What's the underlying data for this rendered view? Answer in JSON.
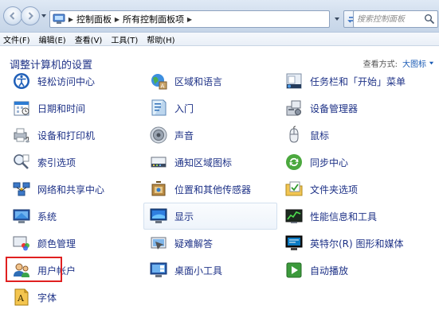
{
  "address_bar": {
    "breadcrumbs": [
      "控制面板",
      "所有控制面板项"
    ],
    "search_placeholder": "搜索控制面板"
  },
  "menubar": {
    "items": [
      "文件(F)",
      "编辑(E)",
      "查看(V)",
      "工具(T)",
      "帮助(H)"
    ]
  },
  "content": {
    "title": "调整计算机的设置",
    "view_label": "查看方式:",
    "view_value": "大图标"
  },
  "items": [
    {
      "label": "轻松访问中心",
      "icon": "ease-of-access-icon"
    },
    {
      "label": "区域和语言",
      "icon": "region-language-icon"
    },
    {
      "label": "任务栏和「开始」菜单",
      "icon": "taskbar-start-menu-icon"
    },
    {
      "label": "日期和时间",
      "icon": "date-time-icon"
    },
    {
      "label": "入门",
      "icon": "getting-started-icon"
    },
    {
      "label": "设备管理器",
      "icon": "device-manager-icon"
    },
    {
      "label": "设备和打印机",
      "icon": "devices-printers-icon"
    },
    {
      "label": "声音",
      "icon": "sound-icon"
    },
    {
      "label": "鼠标",
      "icon": "mouse-icon"
    },
    {
      "label": "索引选项",
      "icon": "indexing-options-icon"
    },
    {
      "label": "通知区域图标",
      "icon": "notification-area-icon"
    },
    {
      "label": "同步中心",
      "icon": "sync-center-icon"
    },
    {
      "label": "网络和共享中心",
      "icon": "network-sharing-icon"
    },
    {
      "label": "位置和其他传感器",
      "icon": "location-sensors-icon"
    },
    {
      "label": "文件夹选项",
      "icon": "folder-options-icon"
    },
    {
      "label": "系统",
      "icon": "system-icon"
    },
    {
      "label": "显示",
      "icon": "display-icon"
    },
    {
      "label": "性能信息和工具",
      "icon": "performance-tools-icon"
    },
    {
      "label": "颜色管理",
      "icon": "color-management-icon"
    },
    {
      "label": "疑难解答",
      "icon": "troubleshooting-icon"
    },
    {
      "label": "英特尔(R) 图形和媒体",
      "icon": "intel-graphics-icon"
    },
    {
      "label": "用户帐户",
      "icon": "user-accounts-icon"
    },
    {
      "label": "桌面小工具",
      "icon": "desktop-gadgets-icon"
    },
    {
      "label": "自动播放",
      "icon": "autoplay-icon"
    },
    {
      "label": "字体",
      "icon": "fonts-icon"
    }
  ],
  "colors": {
    "link_text": "#1e3287",
    "view_value": "#1a5bb5",
    "highlight_border": "#e02020"
  }
}
